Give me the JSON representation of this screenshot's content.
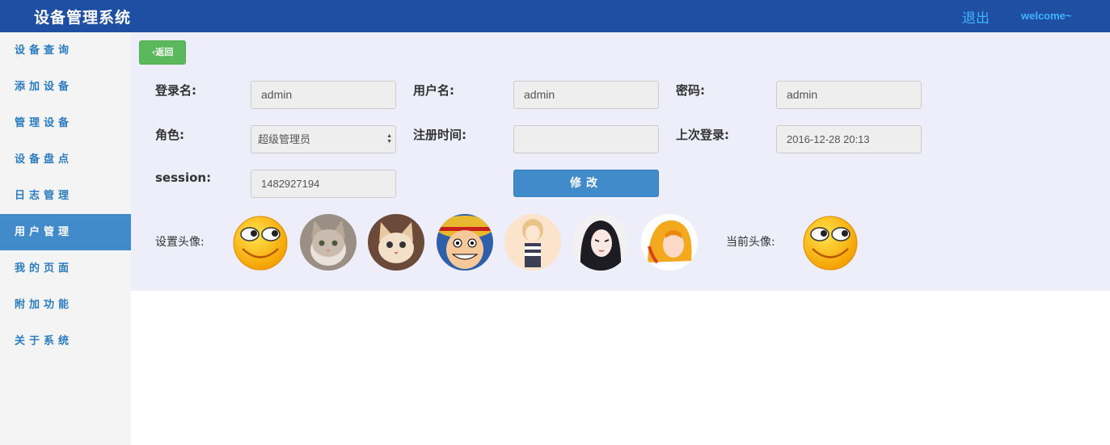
{
  "header": {
    "title": "设备管理系统",
    "logout": "退出",
    "welcome": "welcome~"
  },
  "sidebar": {
    "items": [
      {
        "label": "设备查询",
        "active": false
      },
      {
        "label": "添加设备",
        "active": false
      },
      {
        "label": "管理设备",
        "active": false
      },
      {
        "label": "设备盘点",
        "active": false
      },
      {
        "label": "日志管理",
        "active": false
      },
      {
        "label": "用户管理",
        "active": true
      },
      {
        "label": "我的页面",
        "active": false
      },
      {
        "label": "附加功能",
        "active": false
      },
      {
        "label": "关于系统",
        "active": false
      }
    ]
  },
  "form": {
    "back_label": "返回",
    "login_name_label": "登录名:",
    "login_name_value": "admin",
    "username_label": "用户名:",
    "username_value": "admin",
    "password_label": "密码:",
    "password_value": "admin",
    "role_label": "角色:",
    "role_value": "超级管理员",
    "register_time_label": "注册时间:",
    "register_time_value": "",
    "last_login_label": "上次登录:",
    "last_login_value": "2016-12-28 20:13",
    "session_label": "session:",
    "session_value": "1482927194",
    "submit_label": "修改"
  },
  "avatar_section": {
    "set_label": "设置头像:",
    "current_label": "当前头像:",
    "options": [
      "smiley",
      "cat-gray",
      "cat-orange",
      "pirate-boy",
      "cartoon-girl",
      "anime-woman",
      "blonde-warrior"
    ],
    "current": "smiley"
  },
  "colors": {
    "header": "#1e4fa3",
    "sidebar_active": "#428bca",
    "back_button": "#5cb85c",
    "submit_button": "#428bca",
    "panel": "#eeeefb"
  }
}
